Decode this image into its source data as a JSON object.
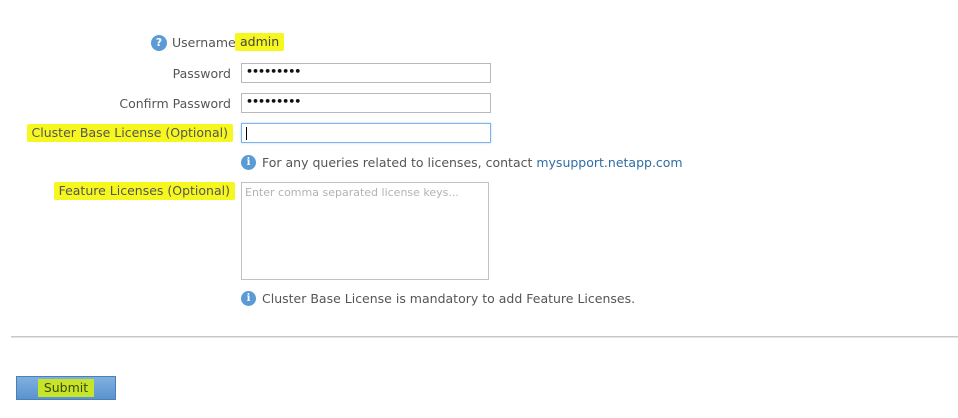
{
  "form": {
    "username": {
      "label": "Username",
      "value": "admin",
      "help_icon": "question-icon",
      "help_glyph": "?"
    },
    "password": {
      "label": "Password",
      "value_masked": "•••••••••"
    },
    "confirm_password": {
      "label": "Confirm Password",
      "value_masked": "•••••••••"
    },
    "cluster_base_license": {
      "label": "Cluster Base License (Optional)",
      "value": ""
    },
    "license_info": {
      "icon": "info-icon",
      "glyph": "i",
      "text": "For any queries related to licenses, contact ",
      "link_text": "mysupport.netapp.com"
    },
    "feature_licenses": {
      "label": "Feature Licenses (Optional)",
      "placeholder": "Enter comma separated license keys..."
    },
    "mandatory_info": {
      "icon": "info-icon",
      "glyph": "i",
      "text": "Cluster Base License is mandatory to add Feature Licenses."
    }
  },
  "actions": {
    "submit_label": "Submit"
  },
  "colors": {
    "highlight": "#f6f71f",
    "info_blue": "#5b9bd5",
    "link": "#2e6da4",
    "button_blue": "#5a93cf",
    "button_label_highlight": "#c6e52a"
  }
}
